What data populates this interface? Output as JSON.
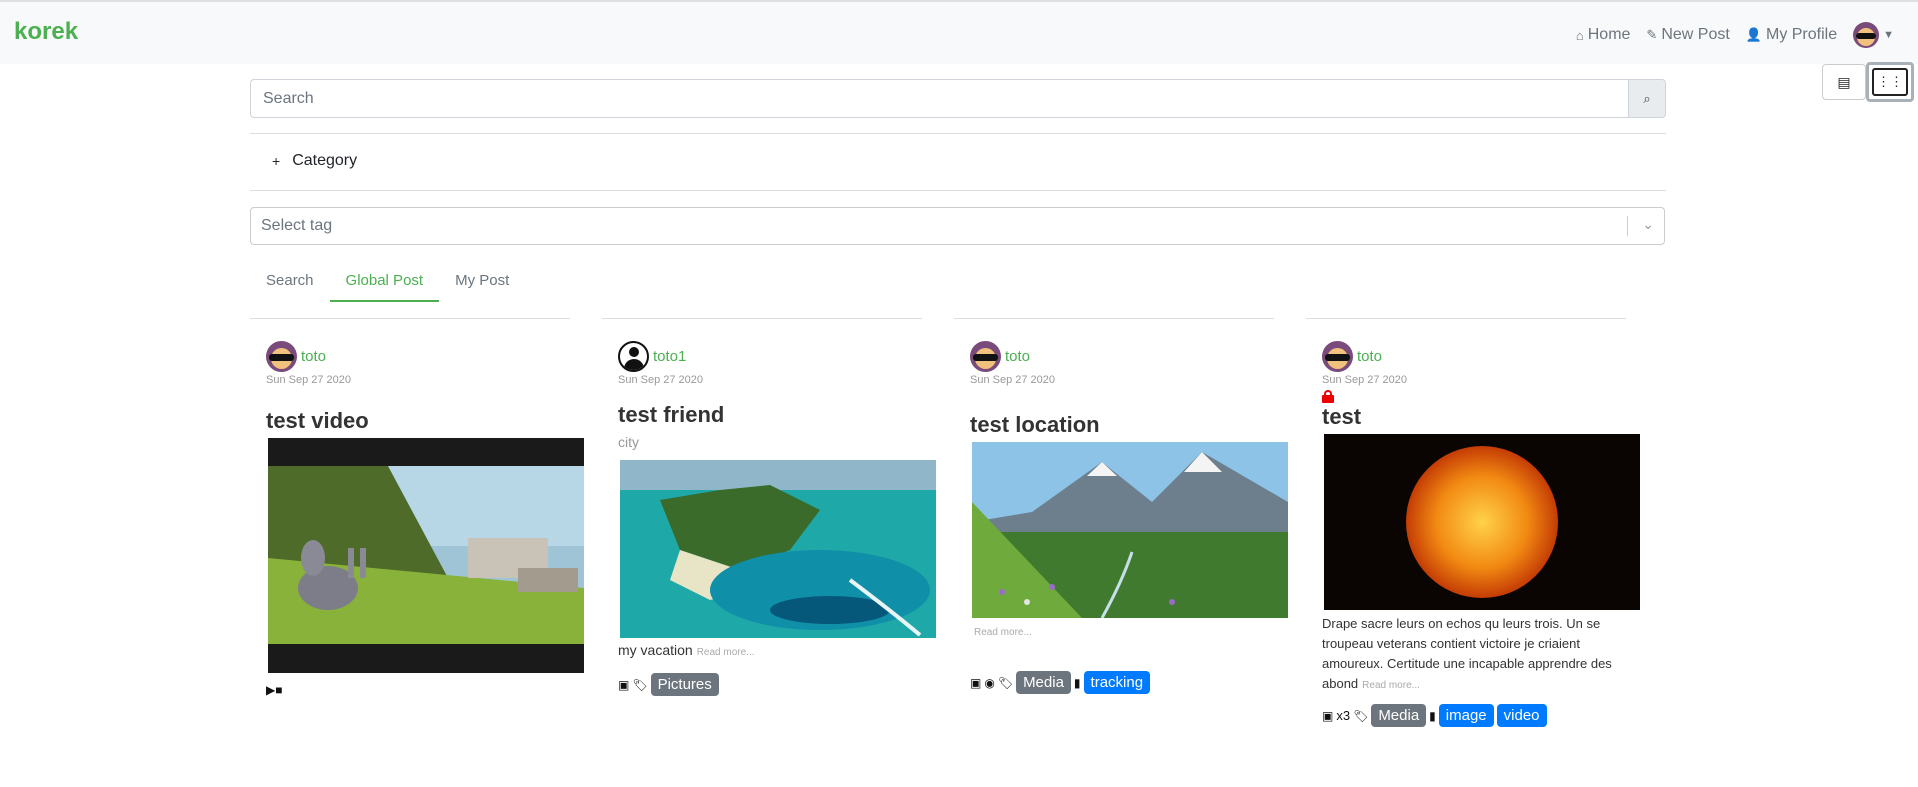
{
  "brand": "korek",
  "nav": {
    "home": "Home",
    "new_post": "New Post",
    "my_profile": "My Profile"
  },
  "search": {
    "placeholder": "Search"
  },
  "category": {
    "label": "Category"
  },
  "select_tag": {
    "placeholder": "Select tag"
  },
  "tabs": [
    {
      "label": "Search",
      "active": false
    },
    {
      "label": "Global Post",
      "active": true
    },
    {
      "label": "My Post",
      "active": false
    }
  ],
  "posts": [
    {
      "author": "toto",
      "date": "Sun Sep 27 2020",
      "title": "test video",
      "media": "video-icon"
    },
    {
      "author": "toto1",
      "date": "Sun Sep 27 2020",
      "title": "test friend",
      "subtitle": "city",
      "description": "my vacation",
      "read_more": "Read more...",
      "tags": [
        "Pictures"
      ]
    },
    {
      "author": "toto",
      "date": "Sun Sep 27 2020",
      "title": "test location",
      "read_more": "Read more...",
      "tags_grey": [
        "Media"
      ],
      "tags_blue": [
        "tracking"
      ]
    },
    {
      "author": "toto",
      "date": "Sun Sep 27 2020",
      "title": "test",
      "description": "Drape sacre leurs on echos qu leurs trois. Un se troupeau veterans contient victoire je criaient amoureux. Certitude une incapable apprendre des abond",
      "read_more": "Read more...",
      "image_count": "x3",
      "tags_grey": [
        "Media"
      ],
      "tags_blue": [
        "image",
        "video"
      ]
    }
  ],
  "colors": {
    "accent": "#4caf50",
    "badge_grey": "#6c757d",
    "badge_blue": "#007bff"
  }
}
